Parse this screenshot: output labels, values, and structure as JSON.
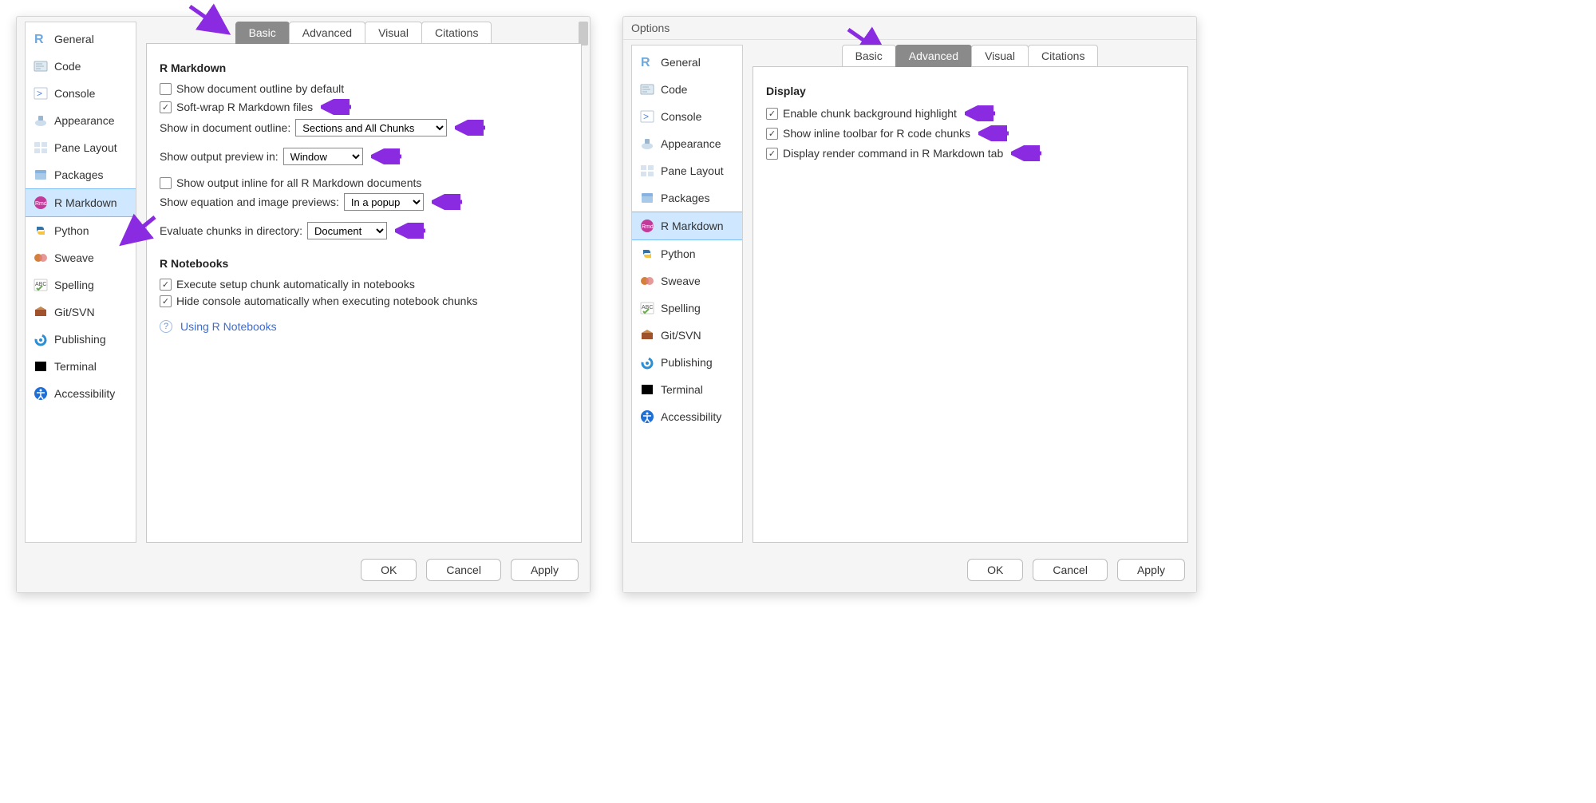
{
  "window_title": "Options",
  "sidebar": {
    "items": [
      {
        "label": "General",
        "icon": "r-logo-icon",
        "color": "#6fa8dc"
      },
      {
        "label": "Code",
        "icon": "code-icon",
        "color": "#9fb8c8"
      },
      {
        "label": "Console",
        "icon": "prompt-icon",
        "color": "#4a86e8"
      },
      {
        "label": "Appearance",
        "icon": "appearance-icon",
        "color": "#7ea6c4"
      },
      {
        "label": "Pane Layout",
        "icon": "panes-icon",
        "color": "#bfd3e6"
      },
      {
        "label": "Packages",
        "icon": "package-icon",
        "color": "#87b3e0"
      },
      {
        "label": "R Markdown",
        "icon": "rmd-icon",
        "color": "#c23b9a"
      },
      {
        "label": "Python",
        "icon": "python-icon",
        "color": "#f4c542"
      },
      {
        "label": "Sweave",
        "icon": "sweave-icon",
        "color": "#d47f3a"
      },
      {
        "label": "Spelling",
        "icon": "spelling-icon",
        "color": "#6aa84f"
      },
      {
        "label": "Git/SVN",
        "icon": "git-icon",
        "color": "#a0522d"
      },
      {
        "label": "Publishing",
        "icon": "publishing-icon",
        "color": "#2b8fd6"
      },
      {
        "label": "Terminal",
        "icon": "terminal-icon",
        "color": "#000000"
      },
      {
        "label": "Accessibility",
        "icon": "accessibility-icon",
        "color": "#1e6fd6"
      }
    ],
    "selected": "R Markdown"
  },
  "tabs": {
    "items": [
      "Basic",
      "Advanced",
      "Visual",
      "Citations"
    ]
  },
  "left_panel": {
    "active_tab": "Basic",
    "section1_title": "R Markdown",
    "show_outline_default": {
      "label": "Show document outline by default",
      "checked": false
    },
    "soft_wrap": {
      "label": "Soft-wrap R Markdown files",
      "checked": true
    },
    "show_in_outline_label": "Show in document outline:",
    "show_in_outline_value": "Sections and All Chunks",
    "show_output_preview_label": "Show output preview in:",
    "show_output_preview_value": "Window",
    "show_output_inline": {
      "label": "Show output inline for all R Markdown documents",
      "checked": false
    },
    "eq_img_preview_label": "Show equation and image previews:",
    "eq_img_preview_value": "In a popup",
    "eval_chunks_label": "Evaluate chunks in directory:",
    "eval_chunks_value": "Document",
    "section2_title": "R Notebooks",
    "exec_setup": {
      "label": "Execute setup chunk automatically in notebooks",
      "checked": true
    },
    "hide_console": {
      "label": "Hide console automatically when executing notebook chunks",
      "checked": true
    },
    "help_link": "Using R Notebooks"
  },
  "right_panel": {
    "active_tab": "Advanced",
    "section_title": "Display",
    "chunk_bg": {
      "label": "Enable chunk background highlight",
      "checked": true
    },
    "inline_toolbar": {
      "label": "Show inline toolbar for R code chunks",
      "checked": true
    },
    "render_cmd": {
      "label": "Display render command in R Markdown tab",
      "checked": true
    }
  },
  "buttons": {
    "ok": "OK",
    "cancel": "Cancel",
    "apply": "Apply"
  },
  "arrow_color": "#8a2be2"
}
